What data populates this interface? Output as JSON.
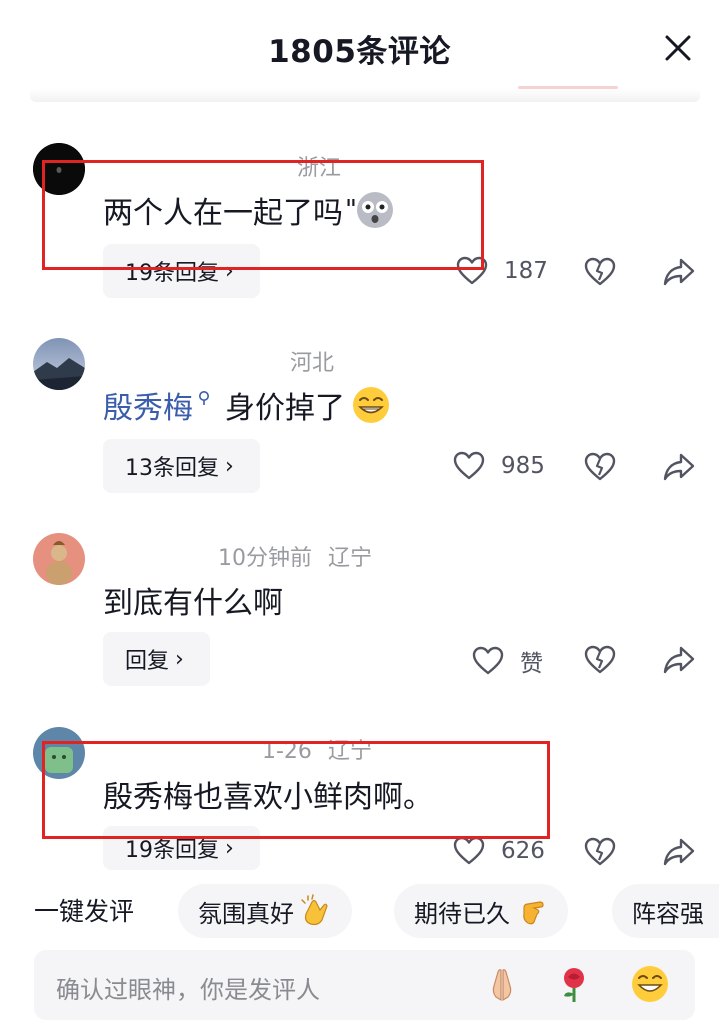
{
  "header": {
    "title": "1805条评论"
  },
  "comments": [
    {
      "location": "浙江",
      "text": "两个人在一起了吗",
      "emoji": "shocked-emoji",
      "reply_label": "19条回复",
      "likes": "187"
    },
    {
      "location": "河北",
      "mention": "殷秀梅",
      "text": "身价掉了",
      "emoji": "grin-emoji",
      "reply_label": "13条回复",
      "likes": "985"
    },
    {
      "time": "10分钟前",
      "location": "辽宁",
      "text": "到底有什么啊",
      "reply_label": "回复",
      "likes": "赞"
    },
    {
      "time": "1-26",
      "location": "辽宁",
      "text": "殷秀梅也喜欢小鲜肉啊。",
      "reply_label": "19条回复",
      "likes": "626"
    }
  ],
  "quick_comments": {
    "label": "一键发评",
    "chips": [
      {
        "text": "氛围真好",
        "icon": "clapping-hands-icon"
      },
      {
        "text": "期待已久",
        "icon": "pointing-hand-icon"
      },
      {
        "text": "阵容强"
      }
    ]
  },
  "input": {
    "placeholder": "确认过眼神，你是发评人",
    "emojis": [
      "praying-hands-icon",
      "rose-icon",
      "grin-face-icon"
    ]
  },
  "colors": {
    "highlight": "#e02424",
    "mention": "#3b5dab",
    "meta": "#9a9ba1",
    "pill_bg": "#f5f5f7"
  }
}
